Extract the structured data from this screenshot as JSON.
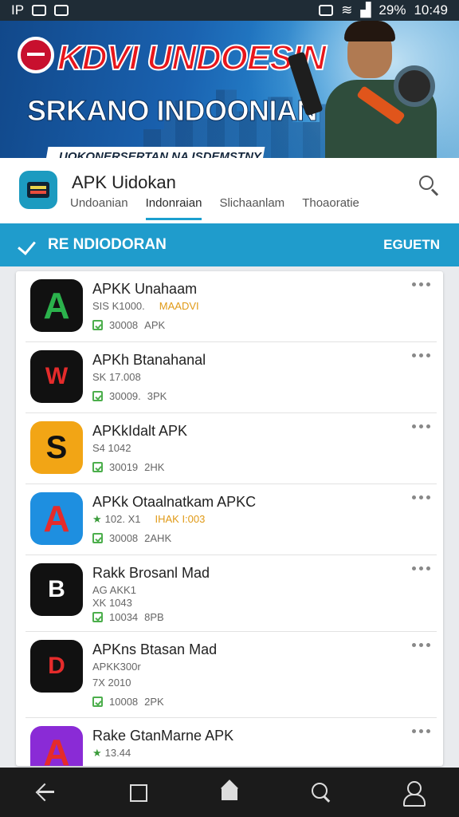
{
  "status": {
    "left": "IP",
    "battery": "29%",
    "time": "10:49"
  },
  "banner": {
    "title": "KDVI UNDOESIN",
    "subtitle": "SRKANO INDOONIAN",
    "strip": "UOKONERSERTAN NA ISDEMSTNY"
  },
  "header": {
    "app_title": "APK Uidokan",
    "tabs": [
      "Undoanian",
      "Indonraian",
      "Slichaanlam",
      "Thoaoratie"
    ]
  },
  "section": {
    "label": "RE NDIODORAN",
    "action": "EGUETN"
  },
  "apps": [
    {
      "name": "APKK Unahaam",
      "meta": "SIS K1000.",
      "tag": "MAADVI",
      "meta2": "",
      "downloads": "30008",
      "size": "APK",
      "icon_color": "#111111",
      "accent": "#2bb24c",
      "glyph": "A"
    },
    {
      "name": "APKh Btanahanal",
      "meta": "SK 17.008",
      "tag": "",
      "meta2": "",
      "downloads": "30009.",
      "size": "3PK",
      "icon_color": "#111111",
      "accent": "#e52b2b",
      "glyph": "W"
    },
    {
      "name": "APKkIdalt APK",
      "meta": "S4 1042",
      "tag": "",
      "meta2": "",
      "downloads": "30019",
      "size": "2HK",
      "icon_color": "#f2a515",
      "accent": "#111111",
      "glyph": "S"
    },
    {
      "name": "APKk Otaalnatkam APKC",
      "meta": "102. X1",
      "tag": "IHAK I:003",
      "meta2": "",
      "downloads": "30008",
      "size": "2AHK",
      "icon_color": "#1e8fe0",
      "accent": "#e52b2b",
      "glyph": "A"
    },
    {
      "name": "Rakk Brosanl Mad",
      "meta": "AG AKK1",
      "tag": "",
      "meta2": "XK 1043",
      "downloads": "10034",
      "size": "8PB",
      "icon_color": "#111111",
      "accent": "#ffffff",
      "glyph": "B"
    },
    {
      "name": "APKns Btasan Mad",
      "meta": "APKK300r",
      "tag": "",
      "meta2": "7X 2010",
      "downloads": "10008",
      "size": "2PK",
      "icon_color": "#111111",
      "accent": "#e52b2b",
      "glyph": "D"
    },
    {
      "name": "Rake GtanMarne APK",
      "meta": "13.44",
      "tag": "",
      "meta2": "",
      "downloads": "",
      "size": "",
      "icon_color": "#8a2bd6",
      "accent": "#e52b2b",
      "glyph": "A"
    }
  ]
}
